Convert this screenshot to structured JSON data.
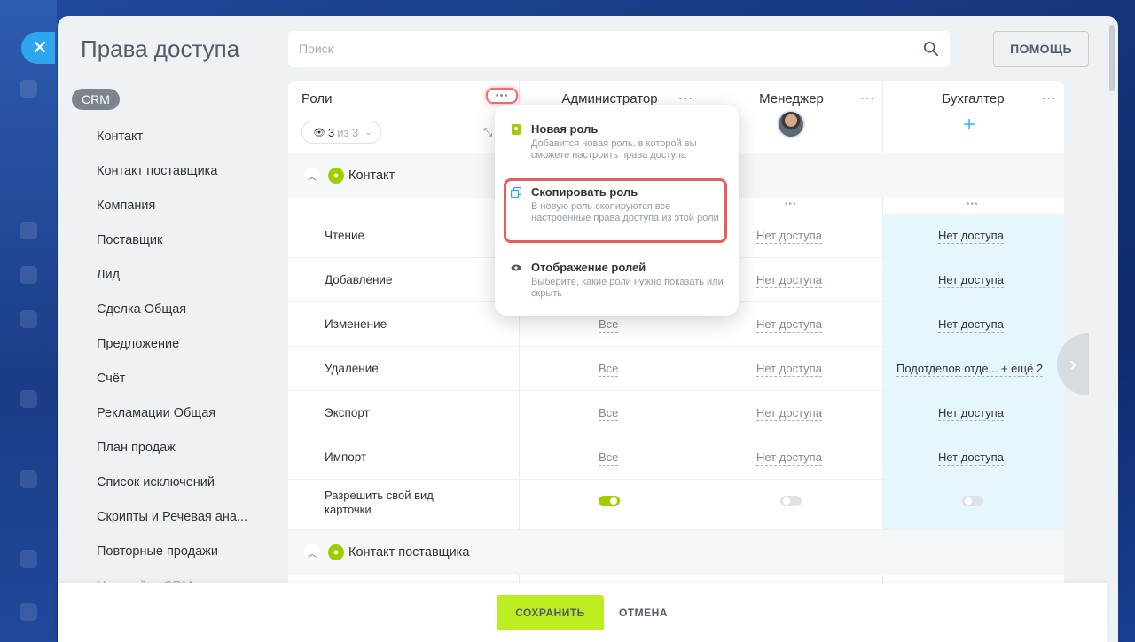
{
  "window": {
    "title": "Права доступа",
    "close_icon": "close-icon"
  },
  "search": {
    "placeholder": "Поиск"
  },
  "help_button": "ПОМОЩЬ",
  "sidebar": {
    "tag": "CRM",
    "items": [
      "Контакт",
      "Контакт поставщика",
      "Компания",
      "Поставщик",
      "Лид",
      "Сделка Общая",
      "Предложение",
      "Счёт",
      "Рекламации Общая",
      "План продаж",
      "Список исключений",
      "Скрипты и Речевая ана...",
      "Повторные продажи",
      "Настройки CRM"
    ]
  },
  "table": {
    "roles_header": "Роли",
    "counter": {
      "value": "3",
      "of": "из 3"
    },
    "columns": [
      "Администратор",
      "Менеджер",
      "Бухгалтер"
    ],
    "group1": "Контакт",
    "group2": "Контакт поставщика",
    "rows": [
      {
        "name": "Чтение",
        "admin": "",
        "manager": "Нет доступа",
        "buh": "Нет доступа"
      },
      {
        "name": "Добавление",
        "admin": "",
        "manager": "Нет доступа",
        "buh": "Нет доступа"
      },
      {
        "name": "Изменение",
        "admin": "Все",
        "manager": "Нет доступа",
        "buh": "Нет доступа"
      },
      {
        "name": "Удаление",
        "admin": "Все",
        "manager": "Нет доступа",
        "buh": "Подотделов отде... + ещё 2"
      },
      {
        "name": "Экспорт",
        "admin": "Все",
        "manager": "Нет доступа",
        "buh": "Нет доступа"
      },
      {
        "name": "Импорт",
        "admin": "Все",
        "manager": "Нет доступа",
        "buh": "Нет доступа"
      }
    ],
    "card_row": {
      "name": "Разрешить свой вид карточки"
    }
  },
  "menu": {
    "items": [
      {
        "title": "Новая роль",
        "desc": "Добавится новая роль, в которой вы сможете настроить права доступа"
      },
      {
        "title": "Скопировать роль",
        "desc": "В новую роль скопируются все настроенные права доступа из этой роли"
      },
      {
        "title": "Отображение ролей",
        "desc": "Выберите, какие роли нужно показать или скрыть"
      }
    ]
  },
  "footer": {
    "save": "СОХРАНИТЬ",
    "cancel": "ОТМЕНА"
  },
  "colors": {
    "accent": "#bbed21",
    "highlight": "#e85c5c",
    "toggle_on": "#9dcf00",
    "plus": "#2fc6f6"
  }
}
